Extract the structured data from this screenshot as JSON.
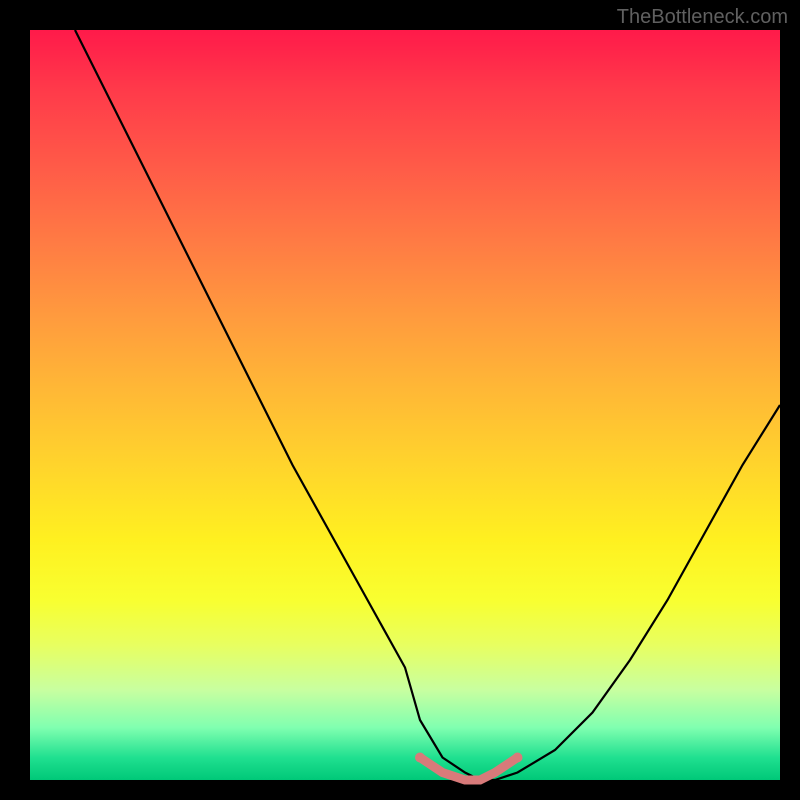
{
  "attribution": "TheBottleneck.com",
  "chart_data": {
    "type": "line",
    "title": "",
    "xlabel": "",
    "ylabel": "",
    "xlim": [
      0,
      100
    ],
    "ylim": [
      0,
      100
    ],
    "background_gradient": [
      "#ff1a4a",
      "#ffd42c",
      "#00c878"
    ],
    "series": [
      {
        "name": "bottleneck-curve",
        "color": "#000000",
        "x": [
          6,
          10,
          15,
          20,
          25,
          30,
          35,
          40,
          45,
          50,
          52,
          55,
          58,
          60,
          62,
          65,
          70,
          75,
          80,
          85,
          90,
          95,
          100
        ],
        "y": [
          100,
          92,
          82,
          72,
          62,
          52,
          42,
          33,
          24,
          15,
          8,
          3,
          1,
          0,
          0,
          1,
          4,
          9,
          16,
          24,
          33,
          42,
          50
        ]
      },
      {
        "name": "optimal-zone-marker",
        "color": "#e08080",
        "x": [
          52,
          55,
          58,
          60,
          62,
          65
        ],
        "y": [
          3,
          1,
          0,
          0,
          1,
          3
        ]
      }
    ]
  }
}
